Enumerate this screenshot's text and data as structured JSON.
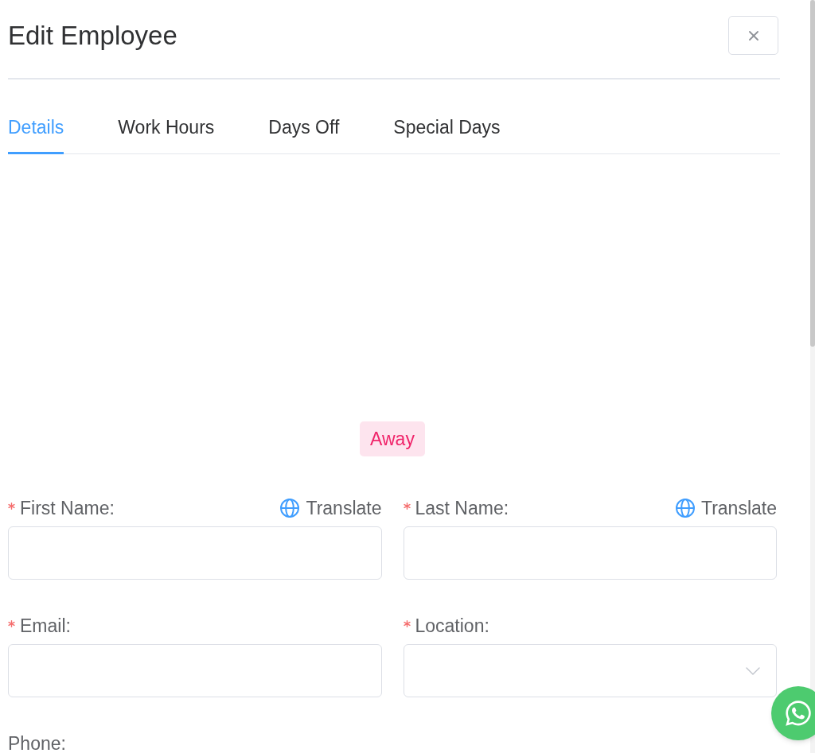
{
  "dialog": {
    "title": "Edit Employee"
  },
  "tabs": [
    {
      "label": "Details",
      "selected": true
    },
    {
      "label": "Work Hours",
      "selected": false
    },
    {
      "label": "Days Off",
      "selected": false
    },
    {
      "label": "Special Days",
      "selected": false
    }
  ],
  "status_badge": {
    "label": "Away"
  },
  "fields": [
    {
      "label": "First Name:",
      "required": true,
      "translate": "Translate",
      "kind": "text"
    },
    {
      "label": "Last Name:",
      "required": true,
      "translate": "Translate",
      "kind": "text"
    },
    {
      "label": "Email:",
      "required": true,
      "kind": "text"
    },
    {
      "label": "Location:",
      "required": true,
      "kind": "select"
    },
    {
      "label": "Phone:",
      "required": false
    }
  ]
}
